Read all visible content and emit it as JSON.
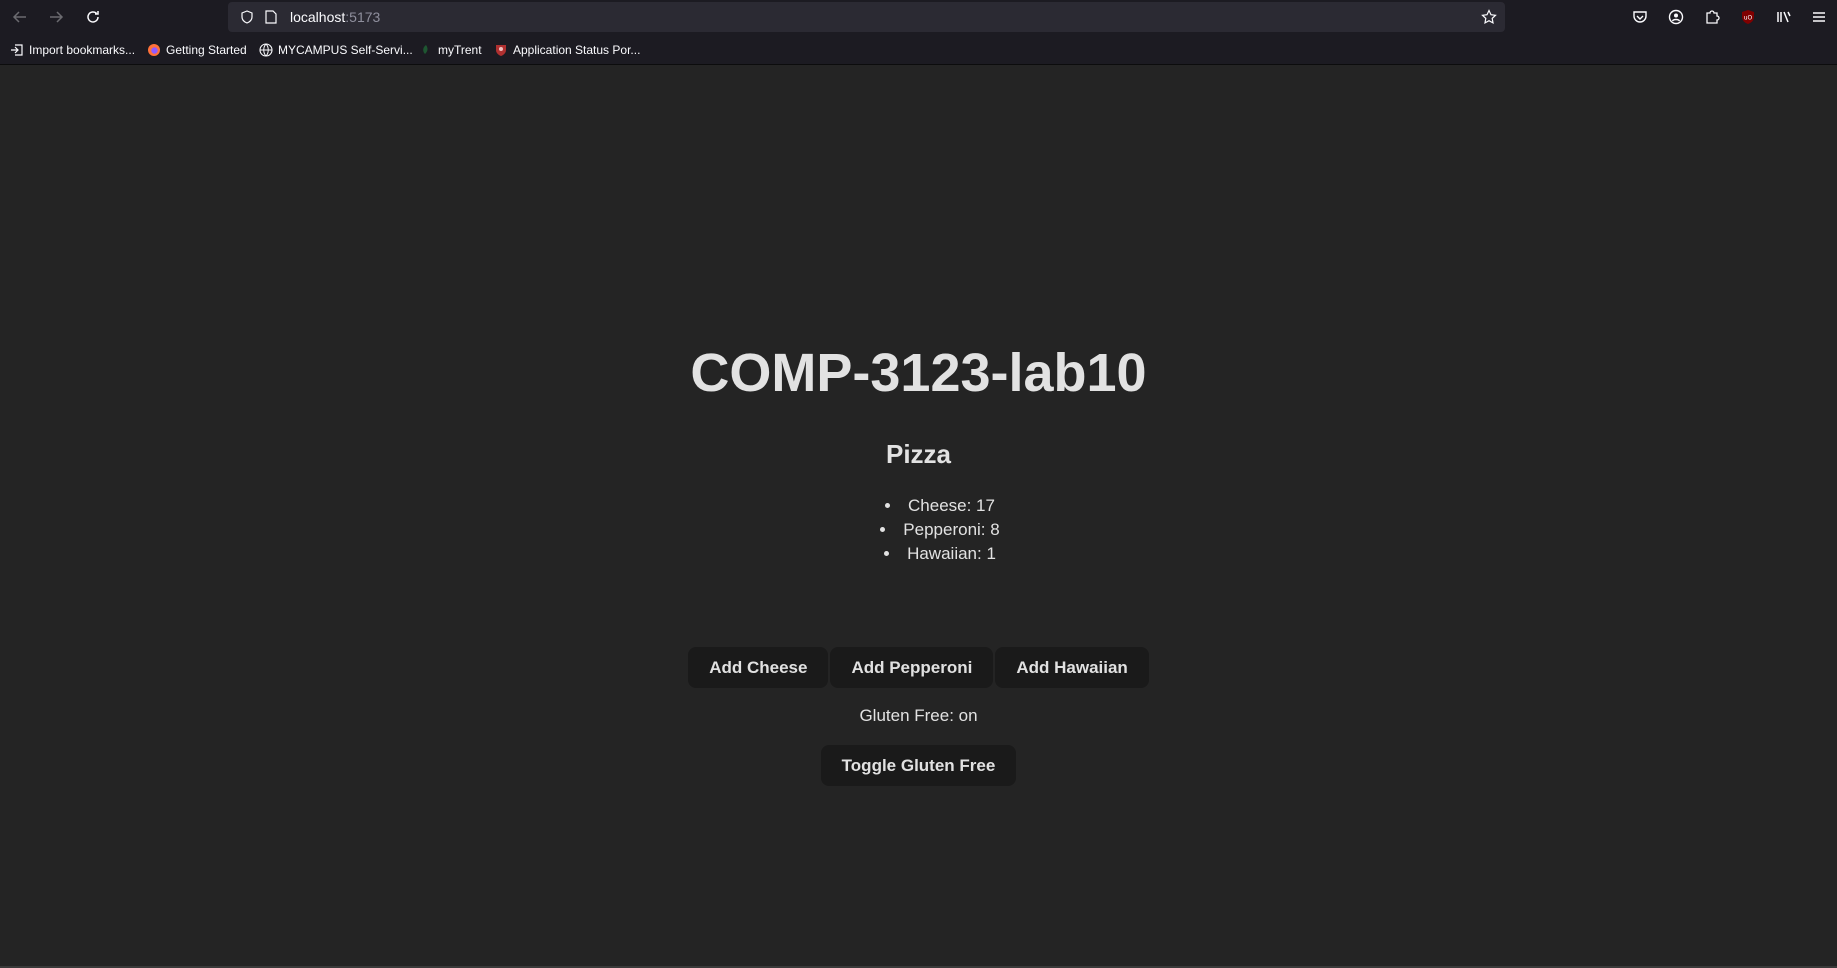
{
  "browser": {
    "url_host": "localhost",
    "url_port": ":5173",
    "bookmarks": [
      {
        "label": "Import bookmarks...",
        "icon": "import-icon"
      },
      {
        "label": "Getting Started",
        "icon": "firefox-icon"
      },
      {
        "label": "MYCAMPUS Self-Servi...",
        "icon": "globe-icon"
      },
      {
        "label": "myTrent",
        "icon": "trent-icon"
      },
      {
        "label": "Application Status Por...",
        "icon": "crest-icon"
      }
    ]
  },
  "app": {
    "title": "COMP-3123-lab10",
    "subtitle": "Pizza",
    "items": [
      "Cheese: 17",
      "Pepperoni: 8",
      "Hawaiian: 1"
    ],
    "buttons": {
      "add_cheese": "Add Cheese",
      "add_pepperoni": "Add Pepperoni",
      "add_hawaiian": "Add Hawaiian",
      "toggle_gluten": "Toggle Gluten Free"
    },
    "gluten_status": "Gluten Free: on"
  },
  "colors": {
    "background": "#242424",
    "button_bg": "#1a1a1a",
    "chrome": "#1c1b22"
  }
}
